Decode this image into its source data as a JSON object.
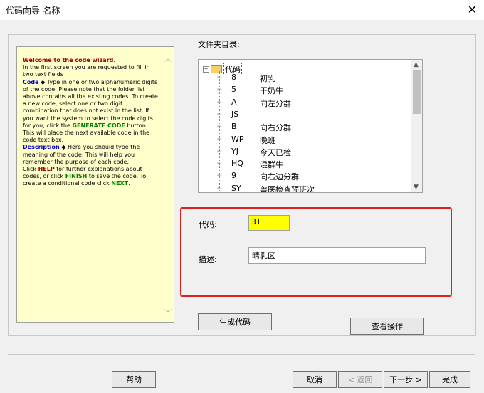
{
  "window": {
    "title": "代码向导-名称",
    "close_glyph": "✕"
  },
  "help": {
    "intro_title": "Welcome to the code wizard.",
    "intro_body": "In the first screen you are requested to fill in two text fields",
    "code_term": "Code",
    "code_body": " Type in one or two alphanumeric digits of the code. Please note that the folder list above contains all the existing codes. To create a new code, select one or two digit combination that does not exist in the list. If you want the system to select the code digits for you, click the ",
    "generate_term": "GENERATE CODE",
    "generate_body": " button. This will place the next available code in the code text box.",
    "description_term": "Description",
    "description_body": " Here you should type the meaning of the code. This will help you remember the purpose of each code.",
    "click_help_pre": "Click ",
    "help_term": "HELP",
    "help_body": " for further explanations about codes, or click ",
    "finish_term": "FINISH",
    "finish_body": " to save the code. To create a conditional code click ",
    "next_term": "NEXT",
    "next_body": ".",
    "bullet_glyph": "◆"
  },
  "tree": {
    "label": "文件夹目录:",
    "root_label": "代码",
    "expand_glyph": "−",
    "rows": [
      {
        "code": "8",
        "name": "初乳"
      },
      {
        "code": "5",
        "name": "干奶牛"
      },
      {
        "code": "A",
        "name": "向左分群"
      },
      {
        "code": "JS",
        "name": ""
      },
      {
        "code": "B",
        "name": "向右分群"
      },
      {
        "code": "WP",
        "name": "晚班"
      },
      {
        "code": "YJ",
        "name": "今天已检"
      },
      {
        "code": "HQ",
        "name": "混群牛"
      },
      {
        "code": "9",
        "name": "向右边分群"
      },
      {
        "code": "SY",
        "name": "兽医检查预班次"
      }
    ]
  },
  "form": {
    "code_label": "代码:",
    "code_value": "3T",
    "desc_label": "描述:",
    "desc_value": "睛乳区"
  },
  "buttons": {
    "generate": "生成代码",
    "view_ops": "查看操作",
    "help": "帮助",
    "cancel": "取消",
    "back": "< 返回",
    "next": "下一步 >",
    "finish": "完成"
  },
  "colors": {
    "highlight": "#e02020",
    "code_field_bg": "#ffff00",
    "help_bg": "#ffffcc"
  }
}
